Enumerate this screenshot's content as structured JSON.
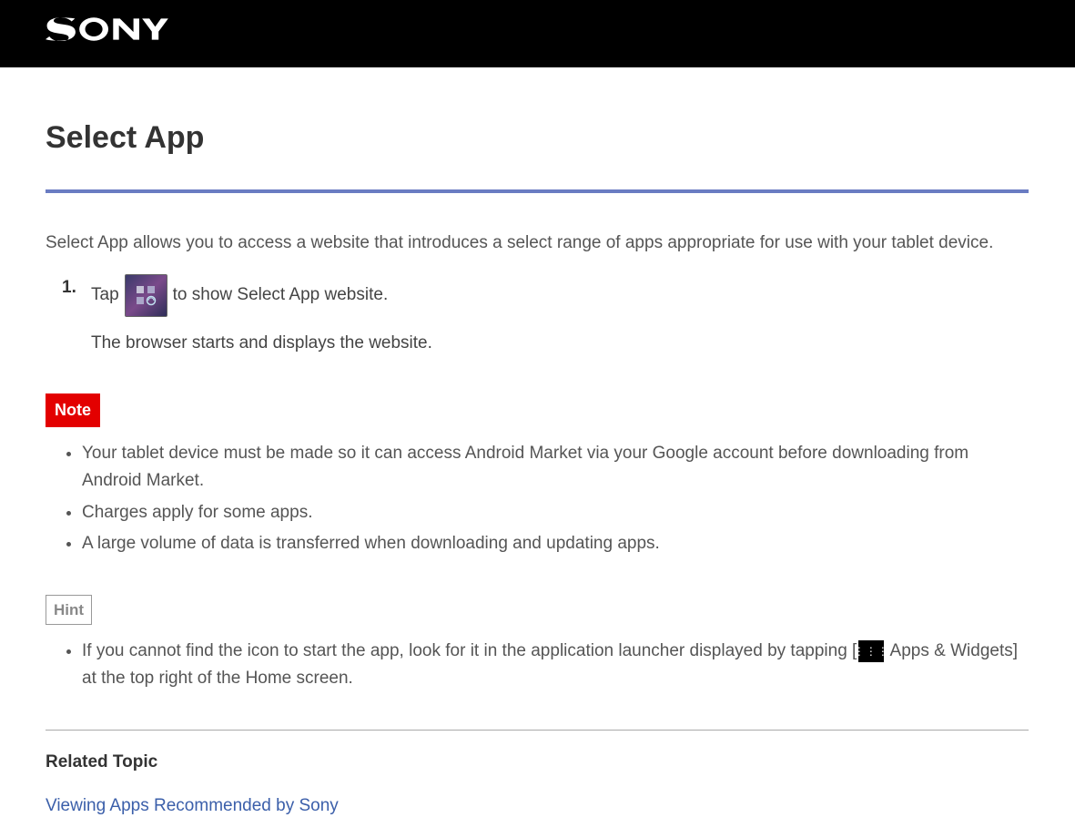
{
  "title": "Select App",
  "intro": "Select App allows you to access a website that introduces a select range of apps appropriate for use with your tablet device.",
  "steps": {
    "s1": {
      "num": "1.",
      "pre": "Tap",
      "post": "to show Select App website.",
      "sub": "The browser starts and displays the website."
    }
  },
  "note": {
    "label": "Note",
    "items": [
      "Your tablet device must be made so it can access Android Market via your Google account before downloading from Android Market.",
      "Charges apply for some apps.",
      "A large volume of data is transferred when downloading and updating apps."
    ]
  },
  "hint": {
    "label": "Hint",
    "item": {
      "pre": "If you cannot find the icon to start the app, look for it in the application launcher displayed by tapping [",
      "post": " Apps & Widgets] at the top right of the Home screen."
    }
  },
  "related": {
    "heading": "Related Topic",
    "link": "Viewing Apps Recommended by Sony"
  }
}
